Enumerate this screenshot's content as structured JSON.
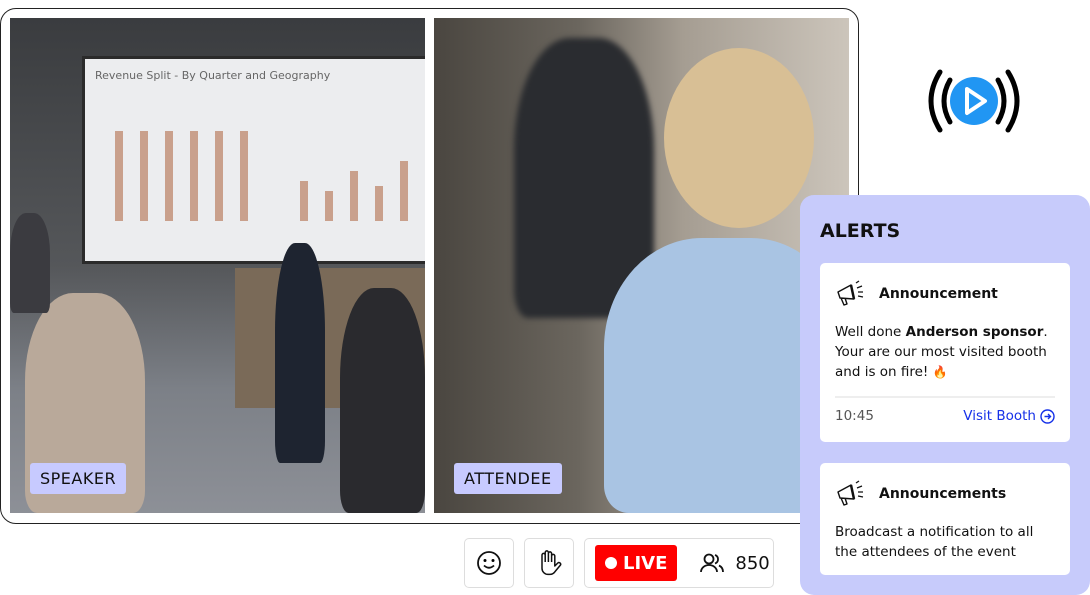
{
  "video": {
    "speaker_label": "SPEAKER",
    "attendee_label": "ATTENDEE",
    "slide_title": "Revenue Split - By Quarter and Geography"
  },
  "broadcast_icon": "live-broadcast-play-icon",
  "controls": {
    "emoji_icon": "smiley-icon",
    "raise_hand_icon": "raised-hand-icon",
    "live_label": "LIVE",
    "viewer_count": "850",
    "live_color": "#ff0000"
  },
  "alerts": {
    "title": "ALERTS",
    "items": [
      {
        "icon": "megaphone-icon",
        "title": "Announcement",
        "message_prefix": "Well done ",
        "message_bold": "Anderson sponsor",
        "message_suffix": ". Your are our most visited booth and is on fire!",
        "emoji": "🔥",
        "time": "10:45",
        "action": "Visit Booth"
      },
      {
        "icon": "megaphone-icon",
        "title": "Announcements",
        "message": "Broadcast a notification to all the attendees of the event"
      }
    ],
    "panel_color": "#c7cbfb",
    "link_color": "#1530e8"
  }
}
